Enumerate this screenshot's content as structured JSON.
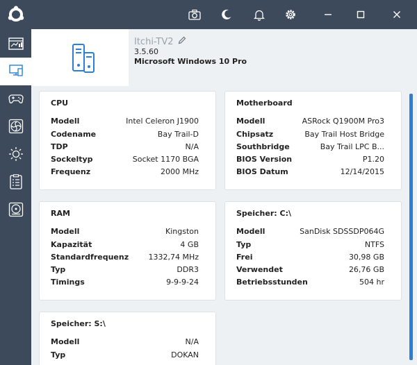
{
  "device": {
    "name": "Itchi-TV2",
    "version": "3.5.60",
    "os": "Microsoft Windows 10 Pro"
  },
  "icons": {
    "logo": "app-logo-icon",
    "camera": "camera-icon",
    "moon": "moon-icon",
    "bell": "bell-icon",
    "gear": "gear-icon",
    "minimize": "minimize-icon",
    "maximize": "maximize-icon",
    "close": "close-icon",
    "edit": "pencil-icon",
    "sidebar": [
      "dashboard-icon",
      "computer-icon",
      "gamepad-icon",
      "fan-icon",
      "brightness-icon",
      "checklist-icon",
      "disk-icon"
    ]
  },
  "colors": {
    "titlebar": "#3c4a5c",
    "accent": "#2a7fd4",
    "background": "#eef1f4"
  },
  "cards": {
    "cpu": {
      "title": "CPU",
      "rows": [
        {
          "key": "Modell",
          "value": "Intel Celeron J1900"
        },
        {
          "key": "Codename",
          "value": "Bay Trail-D"
        },
        {
          "key": "TDP",
          "value": "N/A"
        },
        {
          "key": "Sockeltyp",
          "value": "Socket 1170 BGA"
        },
        {
          "key": "Frequenz",
          "value": "2000 MHz"
        }
      ]
    },
    "motherboard": {
      "title": "Motherboard",
      "rows": [
        {
          "key": "Modell",
          "value": "ASRock Q1900M Pro3"
        },
        {
          "key": "Chipsatz",
          "value": "Bay Trail Host Bridge"
        },
        {
          "key": "Southbridge",
          "value": "Bay Trail LPC B..."
        },
        {
          "key": "BIOS Version",
          "value": "P1.20"
        },
        {
          "key": "BIOS Datum",
          "value": "12/14/2015"
        }
      ]
    },
    "ram": {
      "title": "RAM",
      "rows": [
        {
          "key": "Modell",
          "value": "Kingston"
        },
        {
          "key": "Kapazität",
          "value": "4 GB"
        },
        {
          "key": "Standardfrequenz",
          "value": "1332,74 MHz"
        },
        {
          "key": "Typ",
          "value": "DDR3"
        },
        {
          "key": "Timings",
          "value": "9-9-9-24"
        }
      ]
    },
    "storage_c": {
      "title": "Speicher: C:\\",
      "rows": [
        {
          "key": "Modell",
          "value": "SanDisk SDSSDP064G"
        },
        {
          "key": "Typ",
          "value": "NTFS"
        },
        {
          "key": "Frei",
          "value": "30,98 GB"
        },
        {
          "key": "Verwendet",
          "value": "26,76 GB"
        },
        {
          "key": "Betriebsstunden",
          "value": "504 hr"
        }
      ]
    },
    "storage_s": {
      "title": "Speicher: S:\\",
      "rows": [
        {
          "key": "Modell",
          "value": "N/A"
        },
        {
          "key": "Typ",
          "value": "DOKAN"
        }
      ]
    }
  }
}
